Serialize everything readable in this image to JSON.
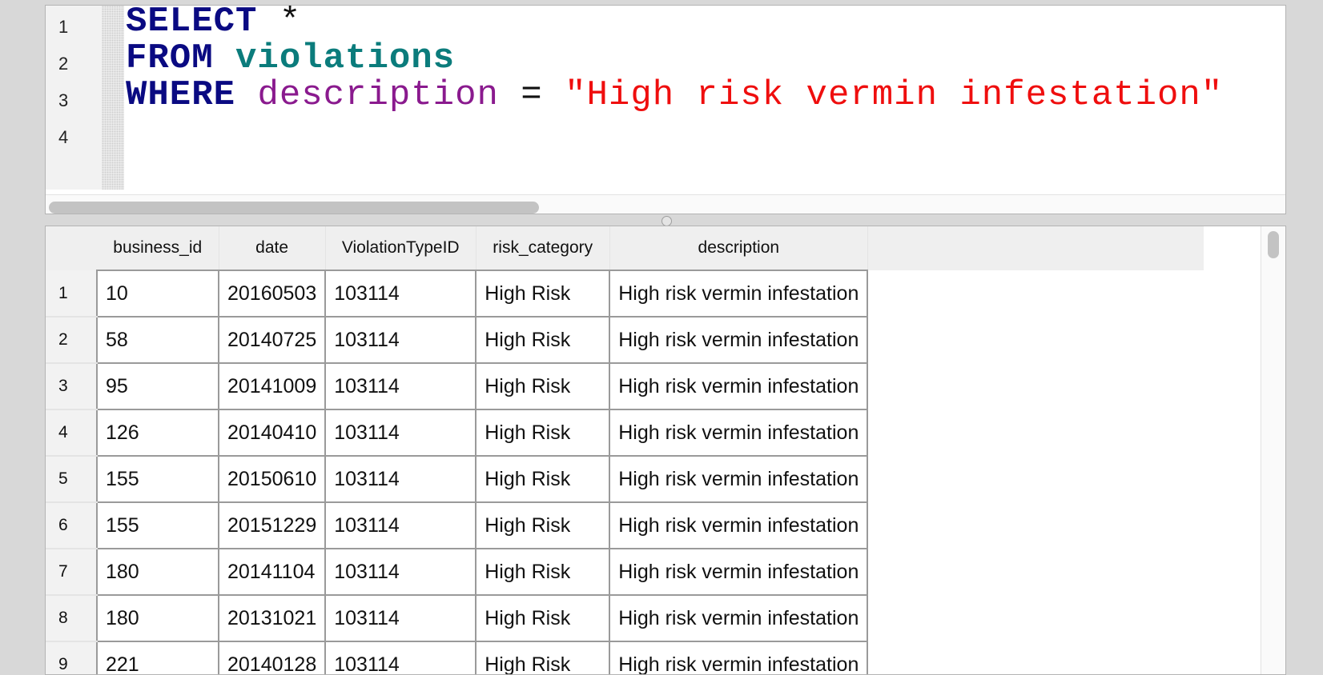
{
  "editor": {
    "line_numbers": [
      "1",
      "2",
      "3",
      "4"
    ],
    "query": {
      "select_kw": "SELECT",
      "star": " *",
      "from_kw": "FROM",
      "table": "violations",
      "where_kw": "WHERE",
      "column": "description",
      "operator": " = ",
      "value": "\"High risk vermin infestation\""
    }
  },
  "results": {
    "columns": [
      "business_id",
      "date",
      "ViolationTypeID",
      "risk_category",
      "description"
    ],
    "rows": [
      {
        "num": "1",
        "business_id": "10",
        "date": "20160503",
        "violation_type_id": "103114",
        "risk_category": "High Risk",
        "description": "High risk vermin infestation"
      },
      {
        "num": "2",
        "business_id": "58",
        "date": "20140725",
        "violation_type_id": "103114",
        "risk_category": "High Risk",
        "description": "High risk vermin infestation"
      },
      {
        "num": "3",
        "business_id": "95",
        "date": "20141009",
        "violation_type_id": "103114",
        "risk_category": "High Risk",
        "description": "High risk vermin infestation"
      },
      {
        "num": "4",
        "business_id": "126",
        "date": "20140410",
        "violation_type_id": "103114",
        "risk_category": "High Risk",
        "description": "High risk vermin infestation"
      },
      {
        "num": "5",
        "business_id": "155",
        "date": "20150610",
        "violation_type_id": "103114",
        "risk_category": "High Risk",
        "description": "High risk vermin infestation"
      },
      {
        "num": "6",
        "business_id": "155",
        "date": "20151229",
        "violation_type_id": "103114",
        "risk_category": "High Risk",
        "description": "High risk vermin infestation"
      },
      {
        "num": "7",
        "business_id": "180",
        "date": "20141104",
        "violation_type_id": "103114",
        "risk_category": "High Risk",
        "description": "High risk vermin infestation"
      },
      {
        "num": "8",
        "business_id": "180",
        "date": "20131021",
        "violation_type_id": "103114",
        "risk_category": "High Risk",
        "description": "High risk vermin infestation"
      },
      {
        "num": "9",
        "business_id": "221",
        "date": "20140128",
        "violation_type_id": "103114",
        "risk_category": "High Risk",
        "description": "High risk vermin infestation"
      }
    ]
  },
  "colors": {
    "keyword": "#0a0a82",
    "table_name": "#0b7c7c",
    "column_name": "#8a1a8e",
    "string_literal": "#ef0e0e"
  }
}
